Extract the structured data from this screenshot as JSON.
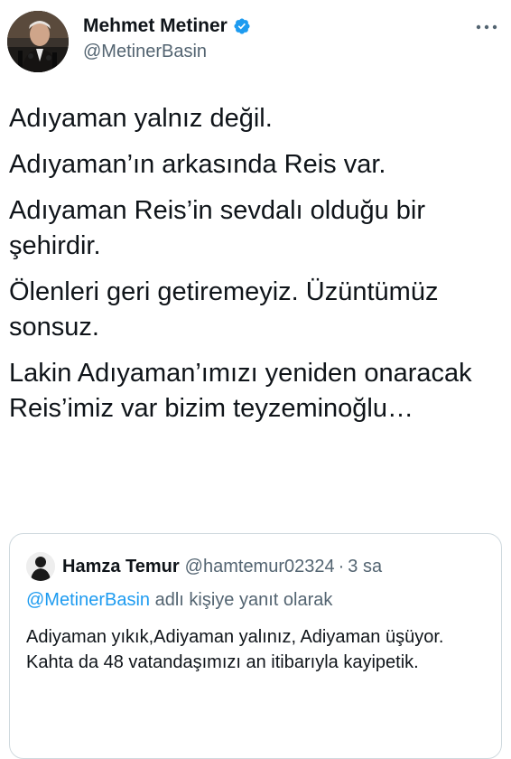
{
  "author": {
    "display_name": "Mehmet Metiner",
    "handle": "@MetinerBasin",
    "verified": true,
    "avatar_icon": "profile-photo"
  },
  "more_icon": "more-horizontal-icon",
  "tweet": {
    "lines": [
      "Adıyaman yalnız değil.",
      "Adıyaman’ın arkasında Reis var.",
      "Adıyaman Reis’in sevdalı olduğu bir şehirdir.",
      "Ölenleri geri getiremeyiz. Üzüntümüz sonsuz.",
      "Lakin Adıyaman’ımızı yeniden onaracak Reis’imiz var bizim teyzeminoğlu…"
    ]
  },
  "quote": {
    "display_name": "Hamza Temur",
    "handle": "@hamtemur02324",
    "separator": "·",
    "time": "3 sa",
    "reply_mention": "@MetinerBasin",
    "reply_suffix": " adlı kişiye yanıt olarak",
    "lines": [
      "Adiyaman yıkık,Adiyaman yalınız, Adiyaman üşüyor.",
      "Kahta da 48 vatandaşımızı an itibarıyla kayipetik."
    ]
  },
  "colors": {
    "text": "#0f1419",
    "secondary": "#536471",
    "link": "#1d9bf0",
    "verified": "#1d9bf0",
    "border": "#cfd9de"
  }
}
